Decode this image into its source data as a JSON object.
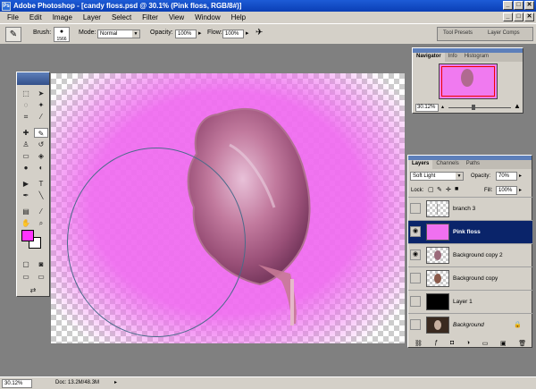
{
  "window": {
    "title": "Adobe Photoshop - [candy floss.psd @ 30.1% (Pink floss, RGB/8#)]",
    "buttons": [
      "_",
      "□",
      "✕"
    ]
  },
  "menu": {
    "items": [
      "File",
      "Edit",
      "Image",
      "Layer",
      "Select",
      "Filter",
      "View",
      "Window",
      "Help"
    ],
    "doc_buttons": [
      "_",
      "□",
      "✕"
    ]
  },
  "options": {
    "brush_label": "Brush:",
    "brush_size": "1566",
    "mode_label": "Mode:",
    "mode_value": "Normal",
    "opacity_label": "Opacity:",
    "opacity_value": "100%",
    "flow_label": "Flow:",
    "flow_value": "100%",
    "well_tabs": [
      "Tool Presets",
      "Layer Comps"
    ]
  },
  "navigator": {
    "tabs": [
      "Navigator",
      "Info",
      "Histogram"
    ],
    "zoom": "30.12%"
  },
  "layers_panel": {
    "tabs": [
      "Layers",
      "Channels",
      "Paths"
    ],
    "blend_mode": "Soft Light",
    "opacity_label": "Opacity:",
    "opacity": "70%",
    "lock_label": "Lock:",
    "fill_label": "Fill:",
    "fill": "100%",
    "layers": [
      {
        "name": "branch 3",
        "visible": false,
        "selected": false
      },
      {
        "name": "Pink floss",
        "visible": true,
        "selected": true
      },
      {
        "name": "Background copy 2",
        "visible": true,
        "selected": false
      },
      {
        "name": "Background copy",
        "visible": false,
        "selected": false
      },
      {
        "name": "Layer 1",
        "visible": false,
        "selected": false
      },
      {
        "name": "Background",
        "visible": false,
        "selected": false
      }
    ]
  },
  "status": {
    "zoom": "30.12%",
    "doc": "Doc: 13.2M/48.3M"
  },
  "colors": {
    "foreground": "#ff33ff",
    "background": "#ffffff",
    "selection": "#0a246a"
  }
}
